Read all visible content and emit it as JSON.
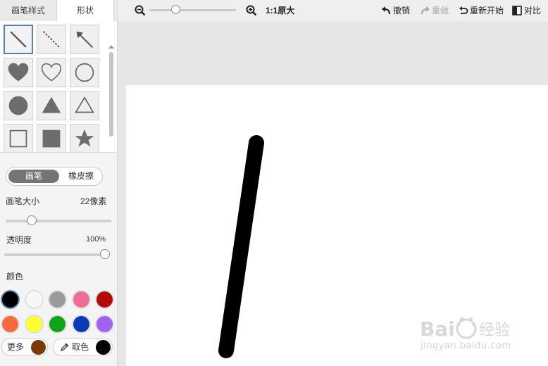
{
  "tabs": {
    "brush_style": "画笔样式",
    "shapes": "形状"
  },
  "shapes": [
    {
      "icon": "line-icon",
      "selected": true
    },
    {
      "icon": "dashed-line-icon"
    },
    {
      "icon": "arrow-icon"
    },
    {
      "icon": "heart-filled-icon"
    },
    {
      "icon": "heart-outline-icon"
    },
    {
      "icon": "circle-outline-icon"
    },
    {
      "icon": "circle-filled-icon"
    },
    {
      "icon": "triangle-filled-icon"
    },
    {
      "icon": "triangle-outline-icon"
    },
    {
      "icon": "square-outline-icon"
    },
    {
      "icon": "square-filled-icon"
    },
    {
      "icon": "star-filled-icon"
    }
  ],
  "mode": {
    "brush": "画笔",
    "eraser": "橡皮擦"
  },
  "brush_size": {
    "label": "画笔大小",
    "value": "22像素",
    "level": 0.22
  },
  "opacity": {
    "label": "透明度",
    "value": "100%",
    "level": 1.0
  },
  "colors": {
    "label": "颜色",
    "swatches": [
      "#000000",
      "#f7f7f7",
      "#9a9a9a",
      "#ee6e93",
      "#b00c0c",
      "#f36b3f",
      "#ffff33",
      "#0fa51b",
      "#083bb4",
      "#a062ef"
    ],
    "selected": "#000000",
    "more_label": "更多",
    "more_color": "#7a3a0a",
    "picker_label": "取色",
    "picker_color": "#000000"
  },
  "toolbar": {
    "zoom_out_icon": "zoom-out-icon",
    "zoom_in_icon": "zoom-in-icon",
    "zoom_level": 0.3,
    "actual_size": "1:1原大",
    "undo": "撤销",
    "redo": "重做",
    "restart": "重新开始",
    "compare": "对比"
  },
  "watermark": {
    "logo": "Bai经验",
    "url": "jingyan.baidu.com"
  }
}
